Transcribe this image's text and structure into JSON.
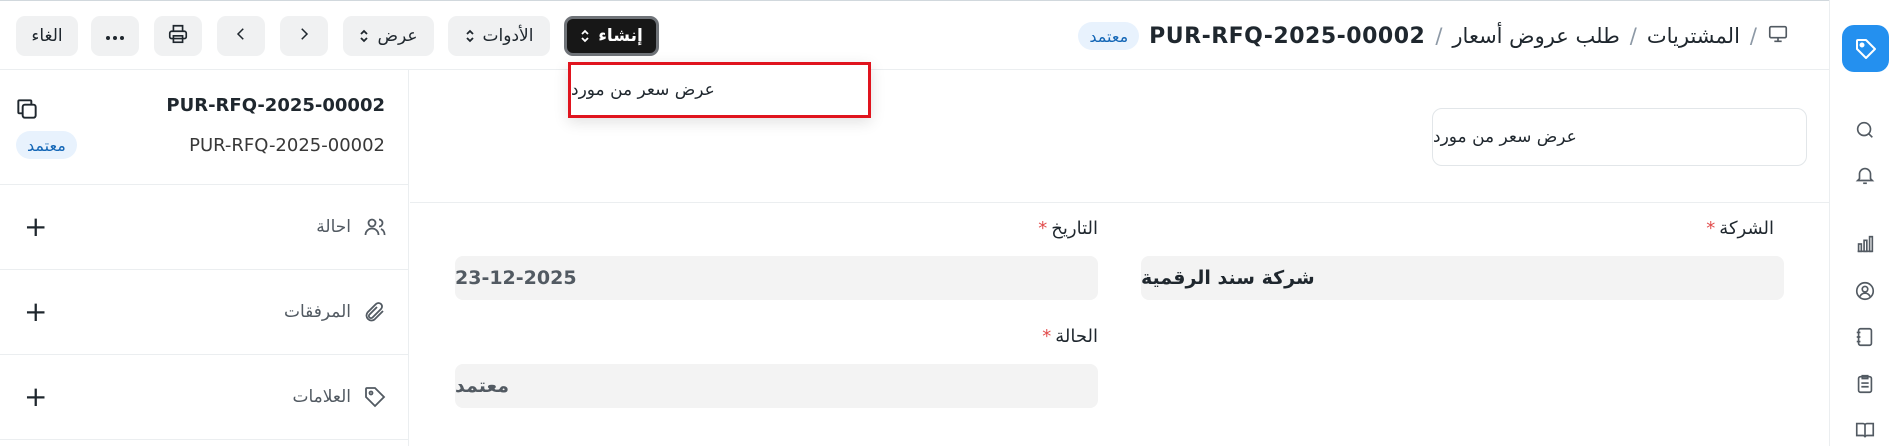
{
  "header": {
    "breadcrumb": {
      "module": "المشتريات",
      "doctype": "طلب عروض أسعار",
      "doc_name": "PUR-RFQ-2025-00002",
      "status_badge": "معتمد"
    },
    "buttons": {
      "create": "إنشاء",
      "tools": "الأدوات",
      "view": "عرض",
      "cancel": "الغاء"
    }
  },
  "create_menu": {
    "items": [
      "عرض سعر من مورد"
    ]
  },
  "sidebar": {
    "doc_title": "PUR-RFQ-2025-00002",
    "doc_subtitle": "PUR-RFQ-2025-00002",
    "status_badge": "معتمد",
    "sections": [
      {
        "label": "احالة",
        "icon": "users-icon"
      },
      {
        "label": "المرفقات",
        "icon": "paperclip-icon"
      },
      {
        "label": "العلامات",
        "icon": "tag-icon"
      }
    ]
  },
  "main": {
    "connection_card": "عرض سعر من مورد",
    "fields": {
      "company": {
        "label": "الشركة",
        "value": "شركة سند الرقمية",
        "required": true
      },
      "date": {
        "label": "التاريخ",
        "value": "23-12-2025",
        "required": true
      },
      "status": {
        "label": "الحالة",
        "value": "معتمد",
        "required": true
      }
    }
  },
  "colors": {
    "accent": "#2490ef",
    "badge_bg": "#e8f2fd",
    "badge_text": "#1366b6",
    "dropdown_highlight": "#e0141e",
    "primary_button": "#171717"
  },
  "rail_icons": [
    "app-logo-icon",
    "search-icon",
    "bell-icon",
    "chart-icon",
    "user-circle-icon",
    "notebook-icon",
    "clipboard-icon",
    "book-icon"
  ]
}
